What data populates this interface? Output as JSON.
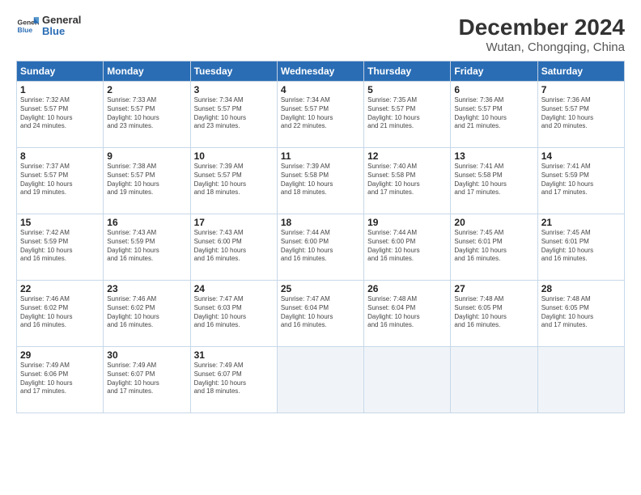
{
  "logo": {
    "line1": "General",
    "line2": "Blue"
  },
  "title": "December 2024",
  "subtitle": "Wutan, Chongqing, China",
  "days_header": [
    "Sunday",
    "Monday",
    "Tuesday",
    "Wednesday",
    "Thursday",
    "Friday",
    "Saturday"
  ],
  "weeks": [
    [
      {
        "day": "1",
        "info": "Sunrise: 7:32 AM\nSunset: 5:57 PM\nDaylight: 10 hours\nand 24 minutes."
      },
      {
        "day": "2",
        "info": "Sunrise: 7:33 AM\nSunset: 5:57 PM\nDaylight: 10 hours\nand 23 minutes."
      },
      {
        "day": "3",
        "info": "Sunrise: 7:34 AM\nSunset: 5:57 PM\nDaylight: 10 hours\nand 23 minutes."
      },
      {
        "day": "4",
        "info": "Sunrise: 7:34 AM\nSunset: 5:57 PM\nDaylight: 10 hours\nand 22 minutes."
      },
      {
        "day": "5",
        "info": "Sunrise: 7:35 AM\nSunset: 5:57 PM\nDaylight: 10 hours\nand 21 minutes."
      },
      {
        "day": "6",
        "info": "Sunrise: 7:36 AM\nSunset: 5:57 PM\nDaylight: 10 hours\nand 21 minutes."
      },
      {
        "day": "7",
        "info": "Sunrise: 7:36 AM\nSunset: 5:57 PM\nDaylight: 10 hours\nand 20 minutes."
      }
    ],
    [
      {
        "day": "8",
        "info": "Sunrise: 7:37 AM\nSunset: 5:57 PM\nDaylight: 10 hours\nand 19 minutes."
      },
      {
        "day": "9",
        "info": "Sunrise: 7:38 AM\nSunset: 5:57 PM\nDaylight: 10 hours\nand 19 minutes."
      },
      {
        "day": "10",
        "info": "Sunrise: 7:39 AM\nSunset: 5:57 PM\nDaylight: 10 hours\nand 18 minutes."
      },
      {
        "day": "11",
        "info": "Sunrise: 7:39 AM\nSunset: 5:58 PM\nDaylight: 10 hours\nand 18 minutes."
      },
      {
        "day": "12",
        "info": "Sunrise: 7:40 AM\nSunset: 5:58 PM\nDaylight: 10 hours\nand 17 minutes."
      },
      {
        "day": "13",
        "info": "Sunrise: 7:41 AM\nSunset: 5:58 PM\nDaylight: 10 hours\nand 17 minutes."
      },
      {
        "day": "14",
        "info": "Sunrise: 7:41 AM\nSunset: 5:59 PM\nDaylight: 10 hours\nand 17 minutes."
      }
    ],
    [
      {
        "day": "15",
        "info": "Sunrise: 7:42 AM\nSunset: 5:59 PM\nDaylight: 10 hours\nand 16 minutes."
      },
      {
        "day": "16",
        "info": "Sunrise: 7:43 AM\nSunset: 5:59 PM\nDaylight: 10 hours\nand 16 minutes."
      },
      {
        "day": "17",
        "info": "Sunrise: 7:43 AM\nSunset: 6:00 PM\nDaylight: 10 hours\nand 16 minutes."
      },
      {
        "day": "18",
        "info": "Sunrise: 7:44 AM\nSunset: 6:00 PM\nDaylight: 10 hours\nand 16 minutes."
      },
      {
        "day": "19",
        "info": "Sunrise: 7:44 AM\nSunset: 6:00 PM\nDaylight: 10 hours\nand 16 minutes."
      },
      {
        "day": "20",
        "info": "Sunrise: 7:45 AM\nSunset: 6:01 PM\nDaylight: 10 hours\nand 16 minutes."
      },
      {
        "day": "21",
        "info": "Sunrise: 7:45 AM\nSunset: 6:01 PM\nDaylight: 10 hours\nand 16 minutes."
      }
    ],
    [
      {
        "day": "22",
        "info": "Sunrise: 7:46 AM\nSunset: 6:02 PM\nDaylight: 10 hours\nand 16 minutes."
      },
      {
        "day": "23",
        "info": "Sunrise: 7:46 AM\nSunset: 6:02 PM\nDaylight: 10 hours\nand 16 minutes."
      },
      {
        "day": "24",
        "info": "Sunrise: 7:47 AM\nSunset: 6:03 PM\nDaylight: 10 hours\nand 16 minutes."
      },
      {
        "day": "25",
        "info": "Sunrise: 7:47 AM\nSunset: 6:04 PM\nDaylight: 10 hours\nand 16 minutes."
      },
      {
        "day": "26",
        "info": "Sunrise: 7:48 AM\nSunset: 6:04 PM\nDaylight: 10 hours\nand 16 minutes."
      },
      {
        "day": "27",
        "info": "Sunrise: 7:48 AM\nSunset: 6:05 PM\nDaylight: 10 hours\nand 16 minutes."
      },
      {
        "day": "28",
        "info": "Sunrise: 7:48 AM\nSunset: 6:05 PM\nDaylight: 10 hours\nand 17 minutes."
      }
    ],
    [
      {
        "day": "29",
        "info": "Sunrise: 7:49 AM\nSunset: 6:06 PM\nDaylight: 10 hours\nand 17 minutes."
      },
      {
        "day": "30",
        "info": "Sunrise: 7:49 AM\nSunset: 6:07 PM\nDaylight: 10 hours\nand 17 minutes."
      },
      {
        "day": "31",
        "info": "Sunrise: 7:49 AM\nSunset: 6:07 PM\nDaylight: 10 hours\nand 18 minutes."
      },
      {
        "day": "",
        "info": ""
      },
      {
        "day": "",
        "info": ""
      },
      {
        "day": "",
        "info": ""
      },
      {
        "day": "",
        "info": ""
      }
    ]
  ]
}
